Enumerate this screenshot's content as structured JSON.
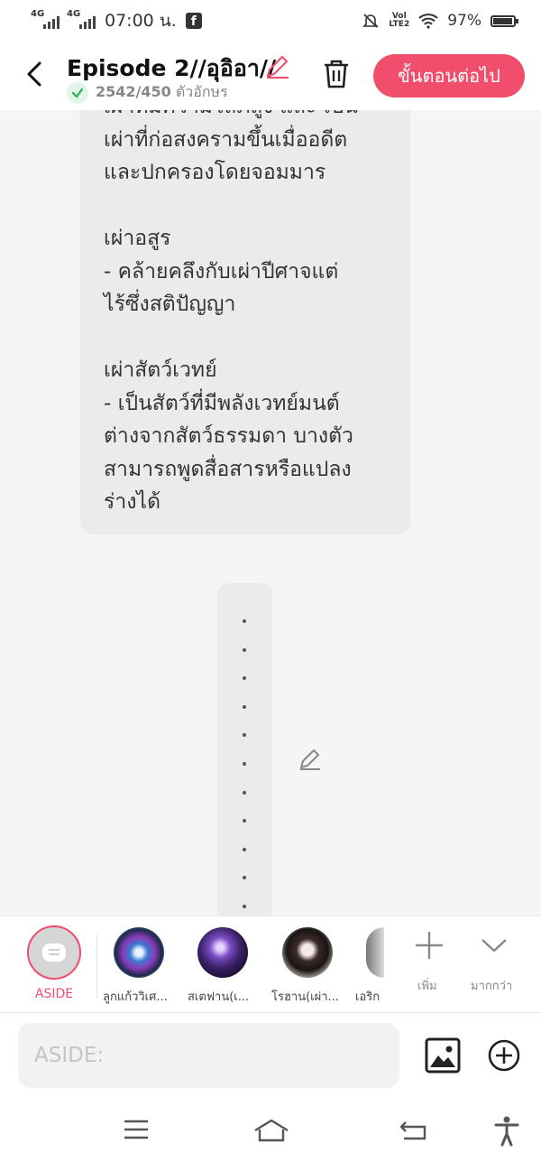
{
  "statusbar": {
    "sim1": "4G",
    "sim2": "4G",
    "time": "07:00 น.",
    "fb_icon": "facebook-icon",
    "volte": "VoLTE2",
    "battery": "97%"
  },
  "header": {
    "title": "Episode 2//อุอิอา//",
    "char_count": "2542/450",
    "char_unit": "ตัวอักษร",
    "next_button": "ขั้นตอนต่อไป"
  },
  "content": {
    "text_bubble": "เผ่าที่มีความโลภสูง และ เป็น\nเผ่าที่ก่อสงครามขึ้นเมื่ออดีต\nและปกครองโดยจอมมาร\n\nเผ่าอสูร\n- คล้ายคลึงกับเผ่าปีศาจแต่\nไร้ซึ่งสติปัญญา\n\nเผ่าสัตว์เวทย์\n- เป็นสัตว์ที่มีพลังเวทย์มนต์\nต่างจากสัตว์ธรรมดา บางตัว\nสามารถพูดสื่อสารหรือแปลง\nร่างได้",
    "dots_count": 11
  },
  "characters": {
    "aside_label": "ASIDE",
    "items": [
      {
        "name": "ลูกแก้ววิเศ..."
      },
      {
        "name": "สเตฟาน(เ..."
      },
      {
        "name": "โรฮาน(เผ่า..."
      },
      {
        "name": "เอริก"
      }
    ],
    "add_label": "เพิ่ม",
    "more_label": "มากกว่า"
  },
  "composer": {
    "placeholder": "ASIDE:"
  },
  "colors": {
    "accent": "#f04e6c",
    "bubble": "#ebebeb",
    "background": "#f5f5f5"
  }
}
